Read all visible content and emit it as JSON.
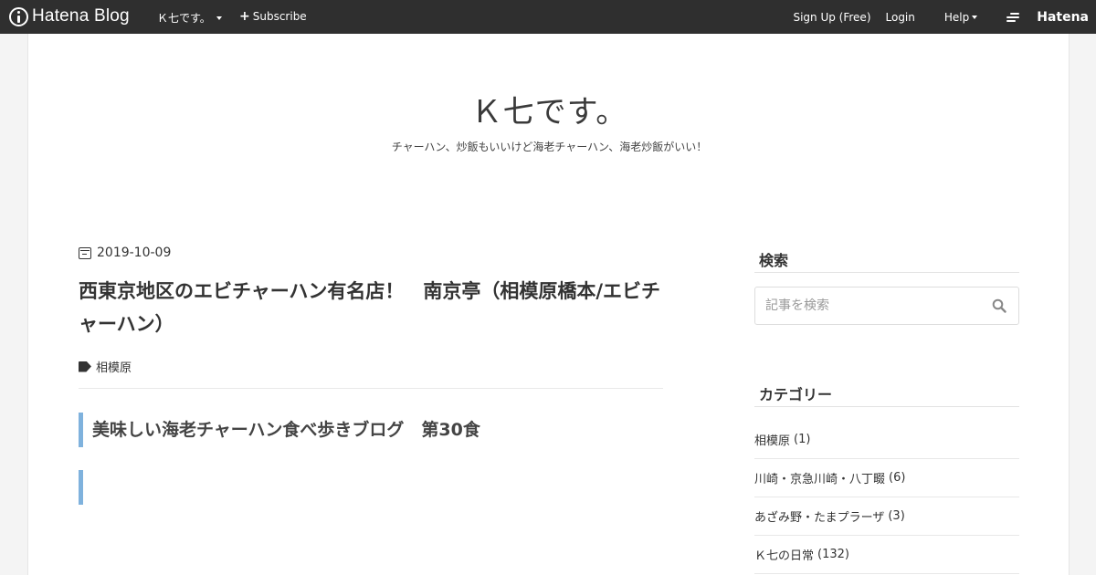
{
  "topbar": {
    "logo_text": "Hatena Blog",
    "blog_name": "Ｋ七です。",
    "subscribe_label": "Subscribe",
    "signup_label": "Sign Up (Free)",
    "login_label": "Login",
    "help_label": "Help",
    "hatena_label": "Hatena"
  },
  "header": {
    "title": "Ｋ七です。",
    "description": "チャーハン、炒飯もいいけど海老チャーハン、海老炒飯がいい！"
  },
  "entry": {
    "date": "2019-10-09",
    "title": "西東京地区のエビチャーハン有名店！　南京亭（相模原橋本/エビチャーハン）",
    "tag": "相模原",
    "heading1": "美味しい海老チャーハン食べ歩きブログ　第30食",
    "heading2": "",
    "partial_text": "-- 。"
  },
  "sidebar": {
    "search_title": "検索",
    "search_placeholder": "記事を検索",
    "category_title": "カテゴリー",
    "categories": [
      {
        "name": "相模原",
        "count": "(1)"
      },
      {
        "name": "川崎・京急川崎・八丁畷",
        "count": "(6)"
      },
      {
        "name": "あざみ野・たまプラーザ",
        "count": "(3)"
      },
      {
        "name": "Ｋ七の日常",
        "count": "(132)"
      }
    ]
  },
  "colors": {
    "topbar_bg": "#2f2f2f",
    "heading_accent": "#7fb2dd"
  }
}
